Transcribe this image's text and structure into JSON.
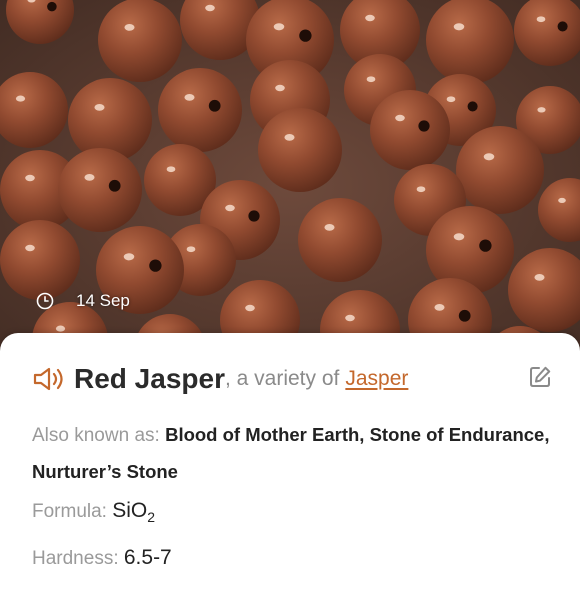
{
  "photo": {
    "alt": "Red Jasper beads",
    "date": "14 Sep",
    "clock_icon": "clock-icon"
  },
  "card": {
    "speaker_icon": "speaker-icon",
    "name": "Red Jasper",
    "variety_prefix": ", a variety of",
    "variety_link": "Jasper",
    "edit_icon": "edit-icon",
    "also_known_label": "Also known as:",
    "also_known_value": "Blood of Mother Earth, Stone of Endurance, Nurturer’s Stone",
    "formula_label": "Formula:",
    "formula_main": "SiO",
    "formula_sub": "2",
    "hardness_label": "Hardness:",
    "hardness_value": "6.5-7"
  },
  "colors": {
    "accent": "#c4682c",
    "bead": "#8e4b30",
    "label_gray": "#9a9a9a"
  }
}
